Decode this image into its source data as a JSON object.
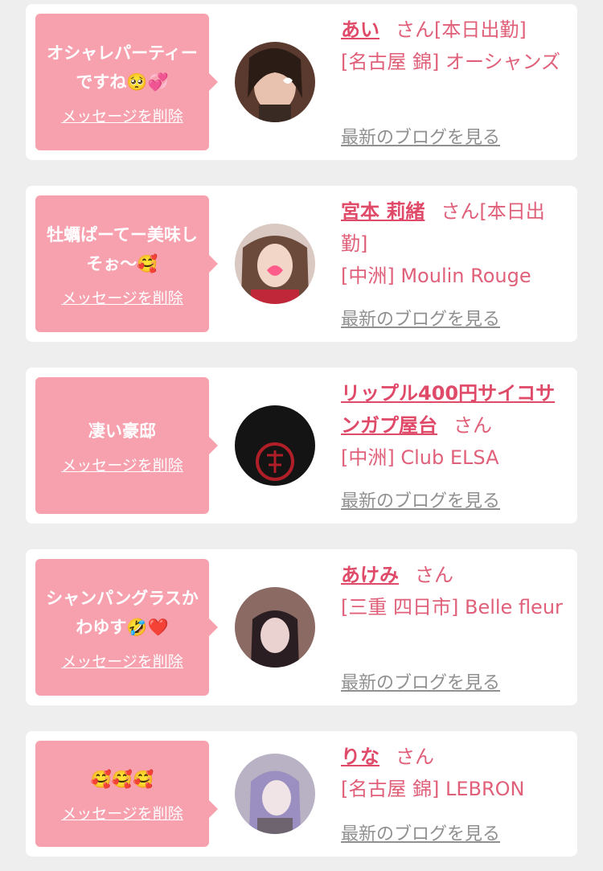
{
  "delete_label": "メッセージを削除",
  "blog_label": "最新のブログを見る",
  "cards": [
    {
      "message": "オシャレパーティーですね🥺💞",
      "name": "あい",
      "honorific": "さん[本日出勤]",
      "shop": "[名古屋 錦] オーシャンズ"
    },
    {
      "message": "牡蠣ぱーてー美味しそぉ〜🥰",
      "name": "宮本 莉緒",
      "honorific": "さん[本日出勤]",
      "shop": "[中洲] Moulin Rouge"
    },
    {
      "message": "凄い豪邸",
      "name": "リップル400円サイコサンガプ屋台",
      "honorific": "さん",
      "shop": "[中洲] Club ELSA"
    },
    {
      "message": "シャンパングラスかわゆす🤣❤️",
      "name": "あけみ",
      "honorific": "さん",
      "shop": "[三重 四日市] Belle fleur"
    },
    {
      "message": "🥰🥰🥰",
      "name": "りな",
      "honorific": "さん",
      "shop": "[名古屋 錦] LEBRON"
    }
  ]
}
